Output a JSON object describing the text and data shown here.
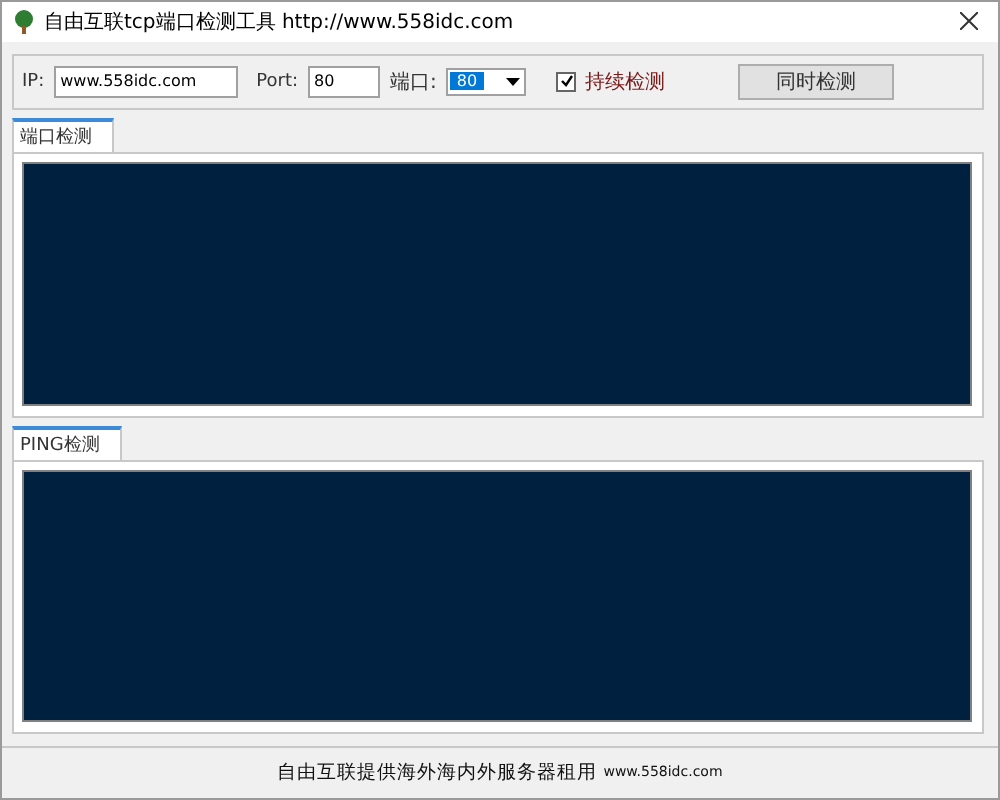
{
  "window": {
    "title": "自由互联tcp端口检测工具 http://www.558idc.com"
  },
  "controls": {
    "ip_label": "IP:",
    "ip_value": "www.558idc.com",
    "port_label": "Port:",
    "port_value": "80",
    "port_select_label": "端口:",
    "port_select_value": "80",
    "continuous": {
      "label": "持续检测",
      "checked": true
    },
    "button": "同时检测"
  },
  "panels": [
    {
      "tab": "端口检测",
      "selected": true
    },
    {
      "tab": "PING检测",
      "selected": true
    }
  ],
  "footer": {
    "text": "自由互联提供海外海内外服务器租用",
    "link": "www.558idc.com"
  }
}
